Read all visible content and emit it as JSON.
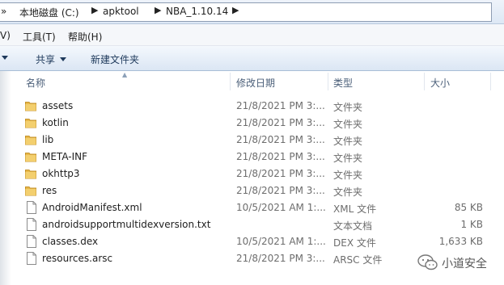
{
  "breadcrumb": {
    "root_partial": "»",
    "items": [
      "本地磁盘 (C:)",
      "apktool",
      "NBA_1.10.14"
    ]
  },
  "menu": {
    "view_partial": "V)",
    "tools": "工具(T)",
    "help": "帮助(H)"
  },
  "toolbar": {
    "share": "共享",
    "new_folder": "新建文件夹"
  },
  "columns": {
    "name": "名称",
    "date": "修改日期",
    "type": "类型",
    "size": "大小"
  },
  "files": [
    {
      "name": "assets",
      "date": "21/8/2021 PM 3:...",
      "type": "文件夹",
      "size": "",
      "icon": "folder-icon"
    },
    {
      "name": "kotlin",
      "date": "21/8/2021 PM 3:...",
      "type": "文件夹",
      "size": "",
      "icon": "folder-icon"
    },
    {
      "name": "lib",
      "date": "21/8/2021 PM 3:...",
      "type": "文件夹",
      "size": "",
      "icon": "folder-icon"
    },
    {
      "name": "META-INF",
      "date": "21/8/2021 PM 3:...",
      "type": "文件夹",
      "size": "",
      "icon": "folder-icon"
    },
    {
      "name": "okhttp3",
      "date": "21/8/2021 PM 3:...",
      "type": "文件夹",
      "size": "",
      "icon": "folder-icon"
    },
    {
      "name": "res",
      "date": "21/8/2021 PM 3:...",
      "type": "文件夹",
      "size": "",
      "icon": "folder-icon"
    },
    {
      "name": "AndroidManifest.xml",
      "date": "10/5/2021 AM 1:...",
      "type": "XML 文件",
      "size": "85 KB",
      "icon": "file-icon"
    },
    {
      "name": "androidsupportmultidexversion.txt",
      "date": "",
      "type": "文本文档",
      "size": "1 KB",
      "icon": "file-icon"
    },
    {
      "name": "classes.dex",
      "date": "10/5/2021 AM 1:...",
      "type": "DEX 文件",
      "size": "1,633 KB",
      "icon": "file-icon"
    },
    {
      "name": "resources.arsc",
      "date": "21/8/2021 PM 3:...",
      "type": "ARSC 文件",
      "size": "",
      "icon": "file-icon"
    }
  ],
  "watermark": {
    "text": "小道安全",
    "icon": "wechat-icon"
  },
  "colors": {
    "folder": "#e8b84a",
    "header_text": "#4c607a",
    "toolbar_text": "#1e395b"
  }
}
